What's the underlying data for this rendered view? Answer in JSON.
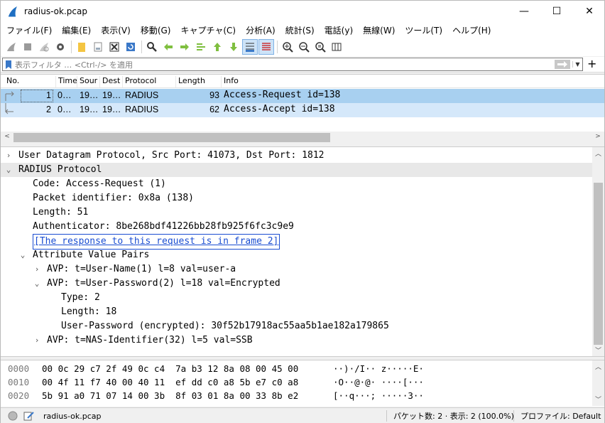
{
  "window": {
    "title": "radius-ok.pcap",
    "controls": {
      "minimize": "—",
      "maximize": "☐",
      "close": "✕"
    }
  },
  "menu": [
    "ファイル(F)",
    "編集(E)",
    "表示(V)",
    "移動(G)",
    "キャプチャ(C)",
    "分析(A)",
    "統計(S)",
    "電話(y)",
    "無線(W)",
    "ツール(T)",
    "ヘルプ(H)"
  ],
  "filter": {
    "placeholder": "表示フィルタ … <Ctrl-/> を適用",
    "apply_icon": "arrow-right-icon",
    "add_label": "+"
  },
  "packet_list": {
    "columns": [
      "No.",
      "Time",
      "Source",
      "Dest",
      "Protocol",
      "Length",
      "Info"
    ],
    "column_display": [
      "No.",
      "Time",
      "Sour",
      "Dest",
      "Protocol",
      "Length",
      "Info"
    ],
    "rows": [
      {
        "no": "1",
        "time": "0…",
        "source": "19…",
        "dest": "19…",
        "protocol": "RADIUS",
        "length": "93",
        "info": "Access-Request id=138"
      },
      {
        "no": "2",
        "time": "0…",
        "source": "19…",
        "dest": "19…",
        "protocol": "RADIUS",
        "length": "62",
        "info": "Access-Accept id=138"
      }
    ]
  },
  "details": {
    "lines": [
      {
        "text": "User Datagram Protocol, Src Port: 41073, Dst Port: 1812",
        "indent": 0,
        "expander": "›"
      },
      {
        "text": "RADIUS Protocol",
        "indent": 0,
        "expander": "⌄"
      },
      {
        "text": "Code: Access-Request (1)",
        "indent": 1,
        "expander": ""
      },
      {
        "text": "Packet identifier: 0x8a (138)",
        "indent": 1,
        "expander": ""
      },
      {
        "text": "Length: 51",
        "indent": 1,
        "expander": ""
      },
      {
        "text": "Authenticator: 8be268bdf41226bb28fb925f6fc3c9e9",
        "indent": 1,
        "expander": ""
      },
      {
        "text": "[The response to this request is in frame 2]",
        "indent": 1,
        "expander": "",
        "link": true
      },
      {
        "text": "Attribute Value Pairs",
        "indent": 1,
        "expander": "⌄"
      },
      {
        "text": "AVP: t=User-Name(1) l=8 val=user-a",
        "indent": 2,
        "expander": "›"
      },
      {
        "text": "AVP: t=User-Password(2) l=18 val=Encrypted",
        "indent": 2,
        "expander": "⌄"
      },
      {
        "text": "Type: 2",
        "indent": 3,
        "expander": ""
      },
      {
        "text": "Length: 18",
        "indent": 3,
        "expander": ""
      },
      {
        "text": "User-Password (encrypted): 30f52b17918ac55aa5b1ae182a179865",
        "indent": 3,
        "expander": ""
      },
      {
        "text": "AVP: t=NAS-Identifier(32) l=5 val=SSB",
        "indent": 2,
        "expander": "›"
      }
    ]
  },
  "hex": [
    {
      "offset": "0000",
      "bytes": "00 0c 29 c7 2f 49 0c c4  7a b3 12 8a 08 00 45 00",
      "ascii": "··)·/I·· z·····E·"
    },
    {
      "offset": "0010",
      "bytes": "00 4f 11 f7 40 00 40 11  ef dd c0 a8 5b e7 c0 a8",
      "ascii": "·O··@·@· ····[···"
    },
    {
      "offset": "0020",
      "bytes": "5b 91 a0 71 07 14 00 3b  8f 03 01 8a 00 33 8b e2",
      "ascii": "[··q···; ·····3··"
    }
  ],
  "status": {
    "file": "radius-ok.pcap",
    "packets": "パケット数: 2 · 表示: 2 (100.0%)",
    "profile": "プロファイル: Default"
  },
  "colors": {
    "row_selected": "#a8d0f0",
    "row_related": "#d5e8fa",
    "link": "#1a4dd1",
    "shark_fin": "#1f6fc2"
  }
}
